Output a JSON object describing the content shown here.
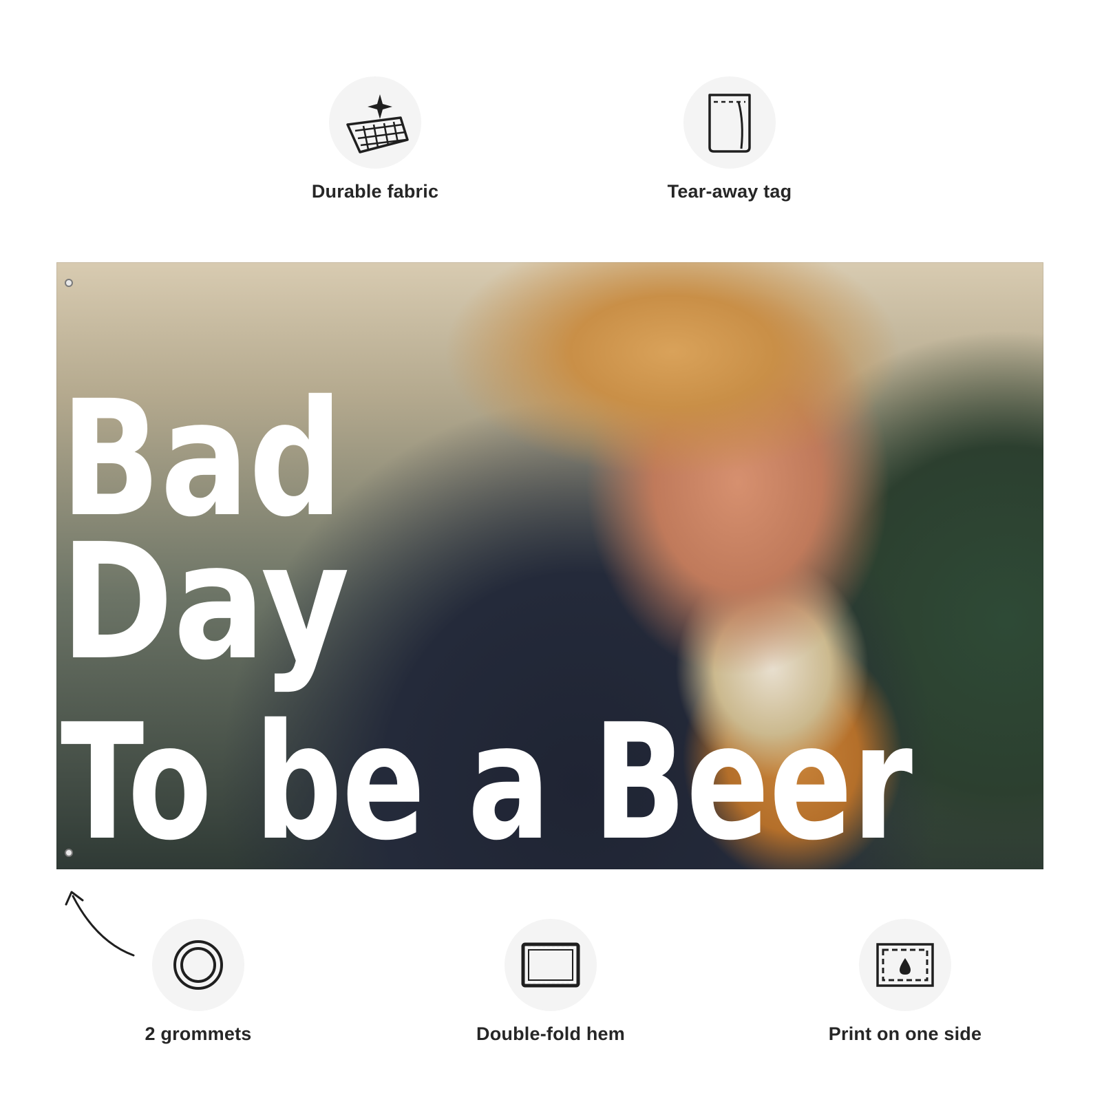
{
  "features": {
    "fabric": {
      "label": "Durable fabric",
      "icon": "fabric-sparkle-icon"
    },
    "tag": {
      "label": "Tear-away tag",
      "icon": "tag-icon"
    },
    "grommets": {
      "label": "2 grommets",
      "icon": "grommet-ring-icon"
    },
    "hem": {
      "label": "Double-fold hem",
      "icon": "hem-frame-icon"
    },
    "print": {
      "label": "Print on one side",
      "icon": "print-drop-icon"
    }
  },
  "flag": {
    "line1": "Bad",
    "line2": "Day",
    "line3": "To be a Beer"
  }
}
